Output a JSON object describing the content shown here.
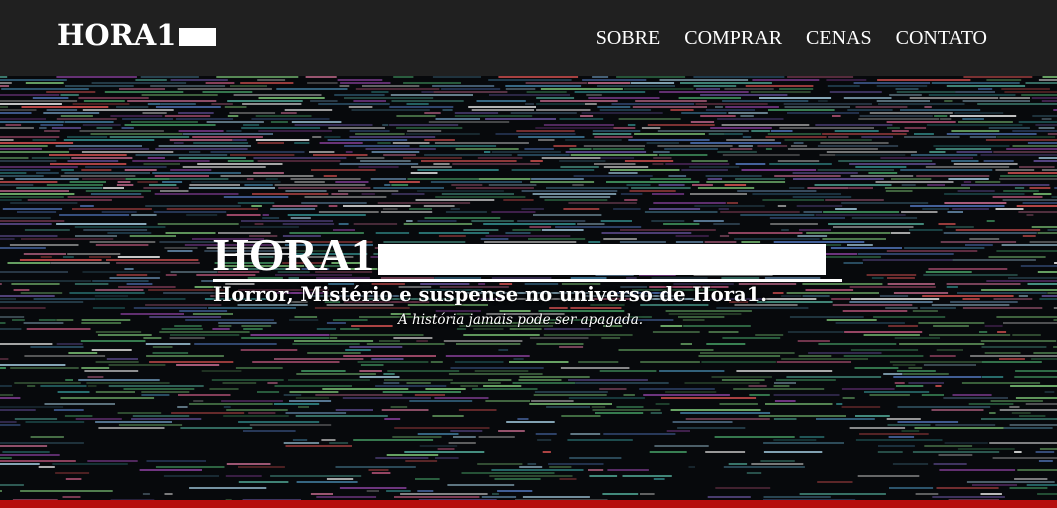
{
  "navbar": {
    "brand": "HORA1",
    "links": [
      {
        "label": "SOBRE"
      },
      {
        "label": "COMPRAR"
      },
      {
        "label": "CENAS"
      },
      {
        "label": "CONTATO"
      }
    ]
  },
  "hero": {
    "title": "HORA1",
    "subtitle": "Horror, Mistério e suspense no universo de Hora1.",
    "tagline": "A história jamais pode ser apagada."
  },
  "colors": {
    "navbar_bg": "#202020",
    "footer_accent": "#b50e0e",
    "text": "#ffffff"
  }
}
